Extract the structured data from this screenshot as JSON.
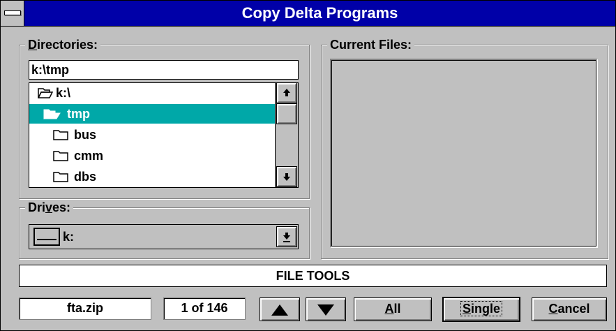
{
  "window": {
    "title": "Copy Delta Programs"
  },
  "directories": {
    "legend_prefix": "D",
    "legend_rest": "irectories:",
    "path_value": "k:\\tmp",
    "items": [
      {
        "label": "k:\\",
        "icon": "open-folder-icon",
        "selected": false,
        "indent": 0
      },
      {
        "label": "tmp",
        "icon": "open-folder-icon",
        "selected": true,
        "indent": 1
      },
      {
        "label": "bus",
        "icon": "folder-icon",
        "selected": false,
        "indent": 2
      },
      {
        "label": "cmm",
        "icon": "folder-icon",
        "selected": false,
        "indent": 2
      },
      {
        "label": "dbs",
        "icon": "folder-icon",
        "selected": false,
        "indent": 2
      }
    ]
  },
  "drives": {
    "legend_a": "Dri",
    "legend_u": "v",
    "legend_b": "es:",
    "selected": "k:",
    "icon": "drive-icon"
  },
  "current_files": {
    "legend": "Current Files:",
    "items": []
  },
  "status": {
    "text": "FILE TOOLS"
  },
  "bottom": {
    "filename": "fta.zip",
    "counter": "1 of 146",
    "up_icon": "up-arrow-icon",
    "down_icon": "down-arrow-icon",
    "all_u": "A",
    "all_rest": "ll",
    "single_u": "S",
    "single_rest": "ingle",
    "cancel_u": "C",
    "cancel_rest": "ancel"
  },
  "colors": {
    "titlebar": "#0000a8",
    "selection": "#00a8a8",
    "face": "#c0c0c0"
  }
}
